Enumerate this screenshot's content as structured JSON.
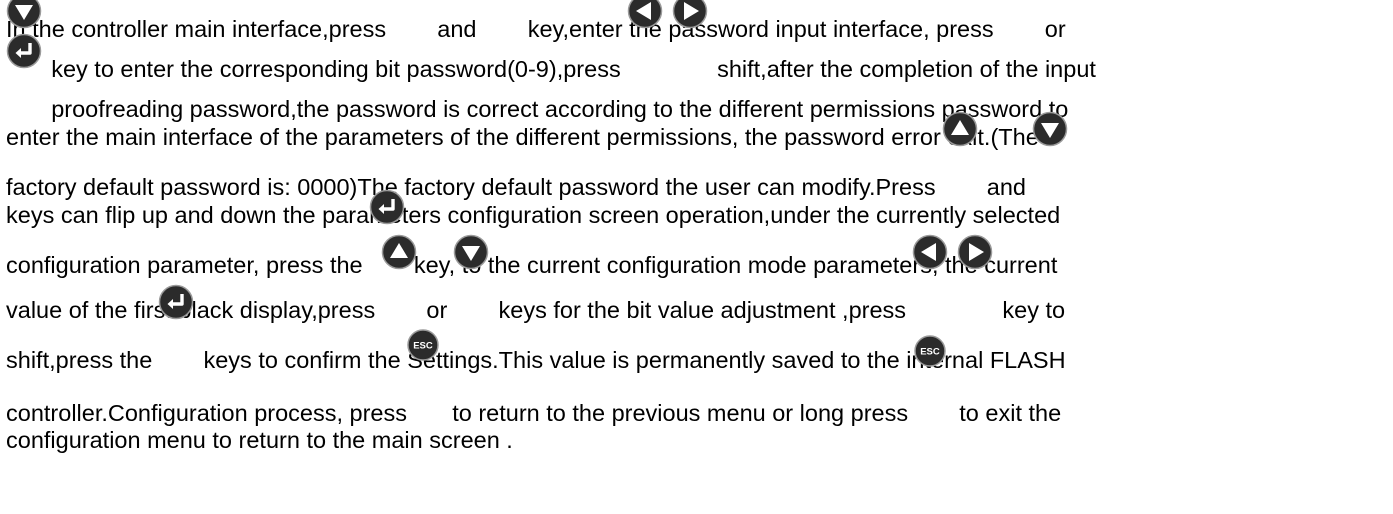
{
  "icons": {
    "power": "power-key-icon",
    "enter": "enter-key-icon",
    "up": "up-arrow-key-icon",
    "down": "down-arrow-key-icon",
    "left": "left-arrow-key-icon",
    "right": "right-arrow-key-icon",
    "esc": "esc-key-icon"
  },
  "colors": {
    "power_key": "#e8433a",
    "key_dark": "#2b2b2b",
    "text": "#000000"
  },
  "esc_label": "ESC",
  "text": {
    "l1a": "In the controller main interface,press",
    "l1b": "and",
    "l1c": "key,enter the password input interface, press",
    "l1d": "or",
    "l2a": "key to enter the corresponding bit password(0-9),press",
    "l2b": "shift,after the completion of the input",
    "l3a": "proofreading password,the password is correct according to the different permissions password to",
    "l4": "enter the main interface of the parameters of the different permissions, the password error exit.(The",
    "l5a": "factory default password is: 0000)The factory default password the user can modify.Press",
    "l5b": "and",
    "l6": "keys can flip up and down the parameters configuration screen operation,under the currently selected",
    "l7a": "configuration parameter, press the",
    "l7b": "key, to the current configuration mode parameters, the current",
    "l8a": "value of the first black display,press",
    "l8b": "or",
    "l8c": "keys for the bit value adjustment ,press",
    "l8d": "key to",
    "l9a": "shift,press the",
    "l9b": "keys to confirm the Settings.This value is permanently saved to the internal FLASH",
    "l10a": "controller.Configuration process, press",
    "l10b": "to return to the previous menu or long press",
    "l10c": "to exit the",
    "l11": "configuration menu to return to the main screen ."
  }
}
